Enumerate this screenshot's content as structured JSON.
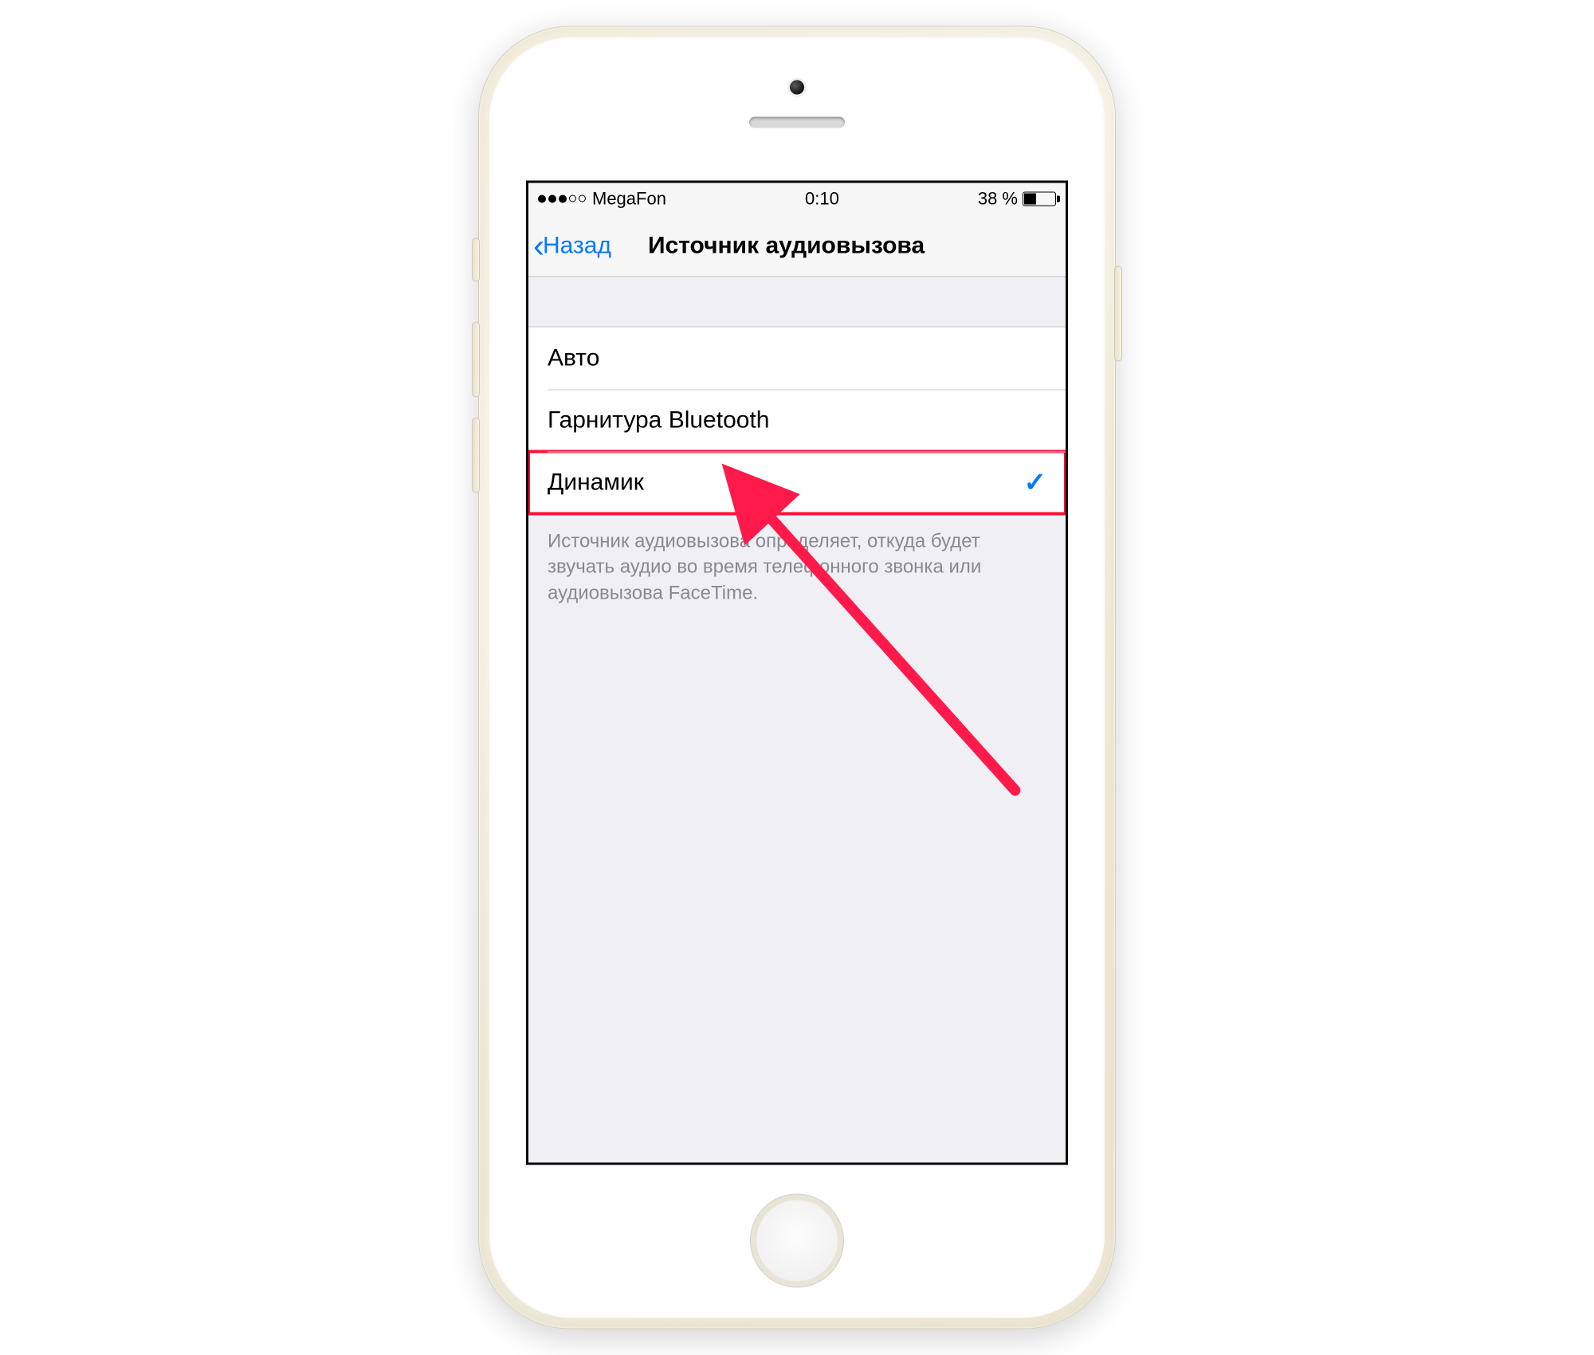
{
  "status": {
    "carrier": "MegaFon",
    "time": "0:10",
    "battery_text": "38 %",
    "battery_level_pct": 38
  },
  "nav": {
    "back_label": "Назад",
    "title": "Источник аудиовызова"
  },
  "options": [
    {
      "label": "Авто",
      "selected": false,
      "highlighted": false
    },
    {
      "label": "Гарнитура Bluetooth",
      "selected": false,
      "highlighted": false
    },
    {
      "label": "Динамик",
      "selected": true,
      "highlighted": true
    }
  ],
  "footer_text": "Источник аудиовызова определяет, откуда будет звучать аудио во время телефонного звонка или аудиовызова FaceTime.",
  "colors": {
    "ios_blue": "#007aff",
    "annotation_red": "#ff1a4b"
  }
}
